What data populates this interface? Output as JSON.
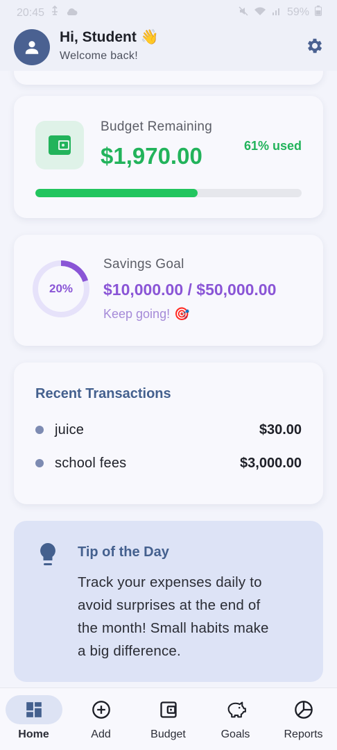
{
  "status_bar": {
    "time": "20:45",
    "battery": "59%"
  },
  "header": {
    "greeting": "Hi, Student",
    "wave_emoji": "👋",
    "subtitle": "Welcome back!"
  },
  "budget": {
    "label": "Budget Remaining",
    "amount": "$1,970.00",
    "used_label": "61% used",
    "used_fraction": 0.61,
    "accent": "#22b35b"
  },
  "savings": {
    "label": "Savings Goal",
    "percent_label": "20%",
    "progress_fraction": 0.2,
    "amount": "$10,000.00 / $50,000.00",
    "note": "Keep going!",
    "note_emoji": "🎯",
    "accent": "#8a55d6"
  },
  "transactions": {
    "title": "Recent Transactions",
    "items": [
      {
        "name": "juice",
        "amount": "$30.00"
      },
      {
        "name": "school fees",
        "amount": "$3,000.00"
      }
    ]
  },
  "tip": {
    "title": "Tip of the Day",
    "lines": [
      "Track your expenses daily to",
      "avoid surprises at the end of",
      "the month! Small habits make",
      "a big difference."
    ]
  },
  "nav": {
    "items": [
      {
        "label": "Home",
        "icon": "dashboard-icon",
        "active": true
      },
      {
        "label": "Add",
        "icon": "add-circle-icon",
        "active": false
      },
      {
        "label": "Budget",
        "icon": "wallet-icon",
        "active": false
      },
      {
        "label": "Goals",
        "icon": "piggy-bank-icon",
        "active": false
      },
      {
        "label": "Reports",
        "icon": "pie-chart-icon",
        "active": false
      }
    ]
  }
}
